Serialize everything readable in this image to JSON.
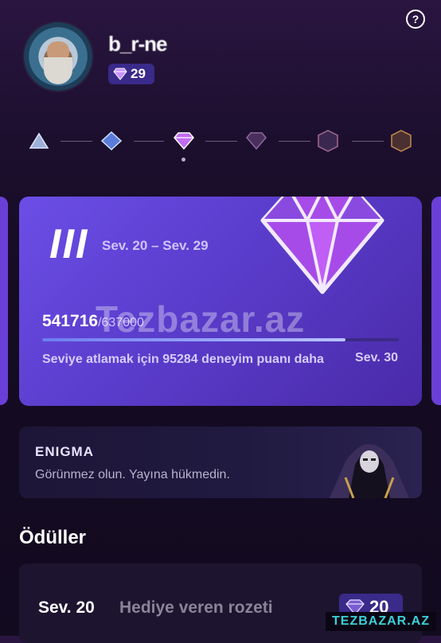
{
  "header": {
    "help_icon": "question-circle-icon",
    "username": "b_r-ne",
    "level": "29",
    "level_icon": "purple-gem-icon"
  },
  "level_track": {
    "tiers": [
      "tier-1-gem",
      "tier-2-gem",
      "tier-3-gem",
      "tier-4-gem",
      "tier-5-gem",
      "tier-6-gem"
    ],
    "current_tier_index": 2
  },
  "level_card": {
    "tier_roman": "III",
    "range": "Sev. 20 – Sev. 29",
    "xp_current": "541716",
    "xp_total": "/637000",
    "progress": 0.85,
    "message": "Seviye atlamak için 95284 deneyim puanı daha",
    "next_level": "Sev. 30",
    "accent": "#6b4ee6"
  },
  "watermark": "Tezbazar.az",
  "enigma": {
    "title": "ENIGMA",
    "subtitle": "Görünmez olun. Yayına hükmedin."
  },
  "rewards": {
    "title": "Ödüller",
    "items": [
      {
        "level": "Sev. 20",
        "name": "Hediye veren rozeti",
        "badge_value": "20"
      }
    ]
  },
  "footer_watermark": "TEZBAZAR.AZ"
}
